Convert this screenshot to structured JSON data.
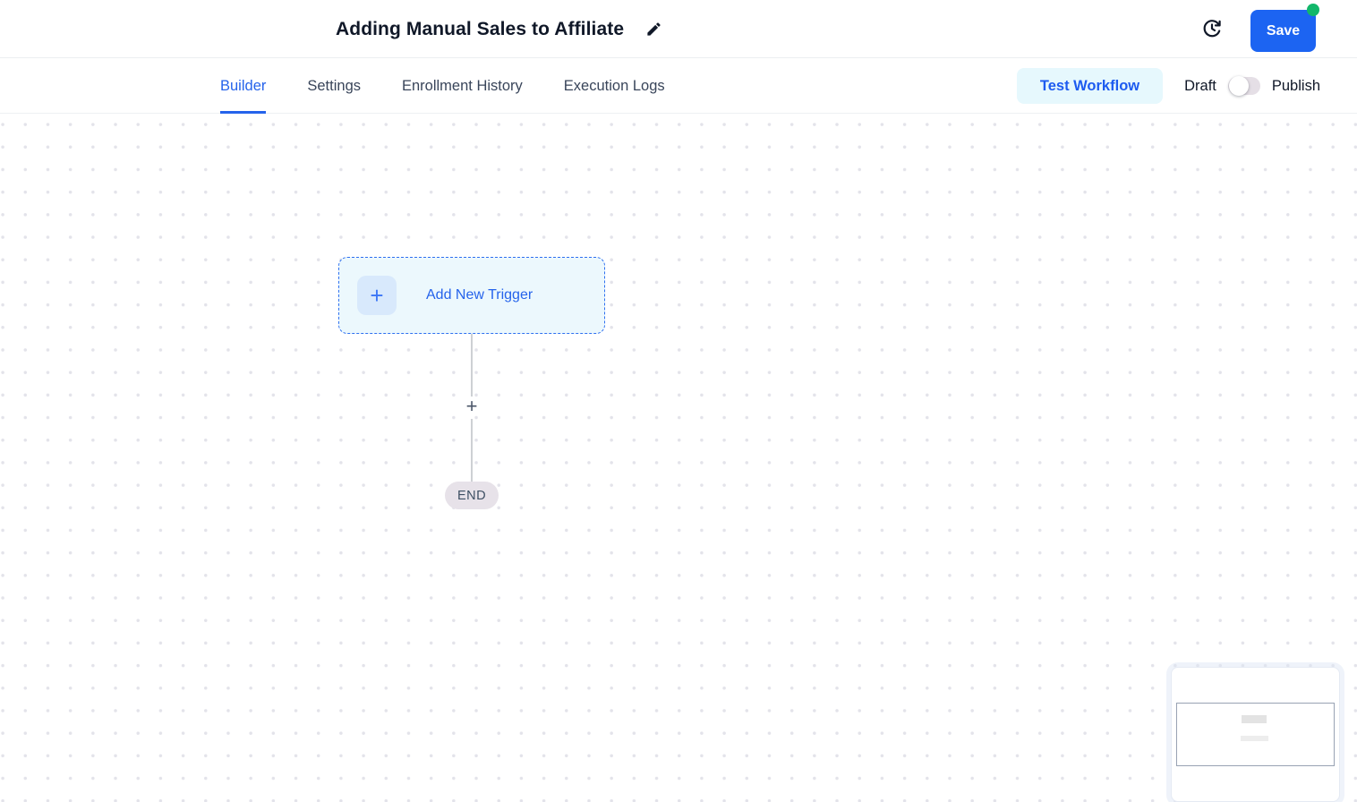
{
  "header": {
    "title": "Adding Manual Sales to Affiliate",
    "save_label": "Save"
  },
  "tabs": [
    {
      "label": "Builder",
      "active": true
    },
    {
      "label": "Settings",
      "active": false
    },
    {
      "label": "Enrollment History",
      "active": false
    },
    {
      "label": "Execution Logs",
      "active": false
    }
  ],
  "toolbar": {
    "test_workflow_label": "Test Workflow",
    "draft_label": "Draft",
    "publish_label": "Publish",
    "publish_toggle_state": "off"
  },
  "canvas": {
    "trigger_plus": "+",
    "trigger_label": "Add New Trigger",
    "connector_add_label": "+",
    "end_label": "END"
  },
  "colors": {
    "accent_blue": "#2563eb",
    "save_button_blue": "#1c64f2",
    "unsaved_dot_green": "#12b76a",
    "test_workflow_bg": "#e6f8fd",
    "trigger_node_bg": "#ecf8fd",
    "trigger_node_border": "#2e70f0",
    "trigger_tile_bg": "#d8e9fc",
    "end_pill_bg": "#e7e2e9",
    "canvas_dot": "#e3e3ea",
    "toggle_track": "#e5dfe6"
  }
}
